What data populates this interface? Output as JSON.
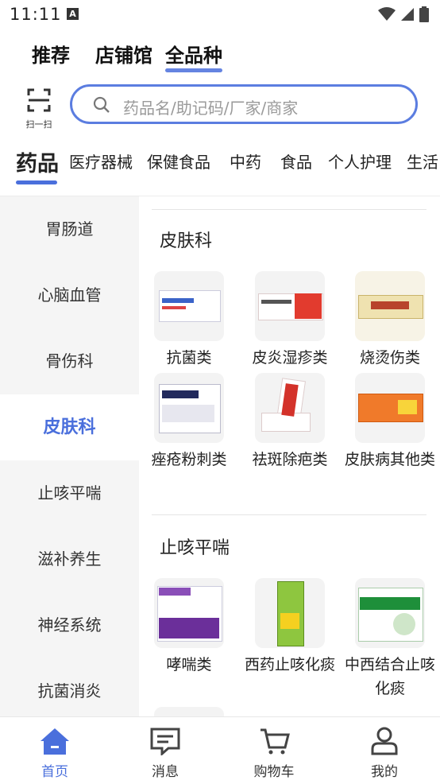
{
  "status": {
    "time": "11:11",
    "notif_icon": "A"
  },
  "topnav": {
    "tabs": [
      "推荐",
      "店铺馆",
      "全品种"
    ],
    "active": 2
  },
  "scan": {
    "label": "扫一扫"
  },
  "search": {
    "placeholder": "药品名/助记码/厂家/商家"
  },
  "categories": [
    "药品",
    "医疗器械",
    "保健食品",
    "中药",
    "食品",
    "个人护理",
    "生活"
  ],
  "sidebar": [
    "胃肠道",
    "心脑血管",
    "骨伤科",
    "皮肤科",
    "止咳平喘",
    "滋补养生",
    "神经系统",
    "抗菌消炎"
  ],
  "sections": [
    {
      "title": "皮肤科",
      "items": [
        "抗菌类",
        "皮炎湿疹类",
        "烧烫伤类",
        "痤疮粉刺类",
        "祛斑除疤类",
        "皮肤病其他类"
      ]
    },
    {
      "title": "止咳平喘",
      "items": [
        "哮喘类",
        "西药止咳化痰",
        "中西结合止咳化痰"
      ]
    }
  ],
  "tabbar": [
    "首页",
    "消息",
    "购物车",
    "我的"
  ],
  "colors": {
    "accent": "#4a6fdc",
    "sidebar_bg": "#f5f5f5"
  }
}
